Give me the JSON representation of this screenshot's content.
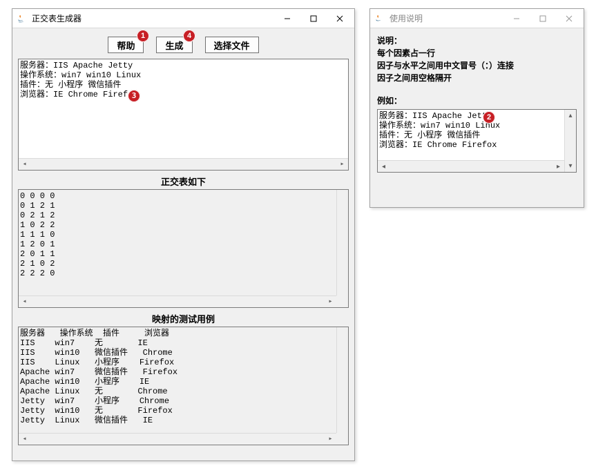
{
  "main": {
    "title": "正交表生成器",
    "toolbar": {
      "help": "帮助",
      "generate": "生成",
      "choose_file": "选择文件"
    },
    "input_text": "服务器：IIS Apache Jetty\n操作系统：win7 win10 Linux\n插件：无 小程序 微信插件\n浏览器：IE Chrome Firefox",
    "section1_label": "正交表如下",
    "orthogonal_text": "0 0 0 0\n0 1 2 1\n0 2 1 2\n1 0 2 2\n1 1 1 0\n1 2 0 1\n2 0 1 1\n2 1 0 2\n2 2 2 0",
    "section2_label": "映射的测试用例",
    "testcases_text": "服务器   操作系统  插件     浏览器\nIIS    win7    无       IE\nIIS    win10   微信插件   Chrome\nIIS    Linux   小程序    Firefox\nApache win7    微信插件   Firefox\nApache win10   小程序    IE\nApache Linux   无       Chrome\nJetty  win7    小程序    Chrome\nJetty  win10   无       Firefox\nJetty  Linux   微信插件   IE"
  },
  "help": {
    "title": "使用说明",
    "desc_label": "说明：",
    "desc_line1": "每个因素占一行",
    "desc_line2": "因子与水平之间用中文冒号（：）连接",
    "desc_line3": "因子之间用空格隔开",
    "example_label": "例如：",
    "example_text": "服务器：IIS Apache Jetty\n操作系统：win7 win10 Linux\n插件：无 小程序 微信插件\n浏览器：IE Chrome Firefox"
  },
  "badges": {
    "b1": "1",
    "b2": "2",
    "b3": "3",
    "b4": "4"
  }
}
